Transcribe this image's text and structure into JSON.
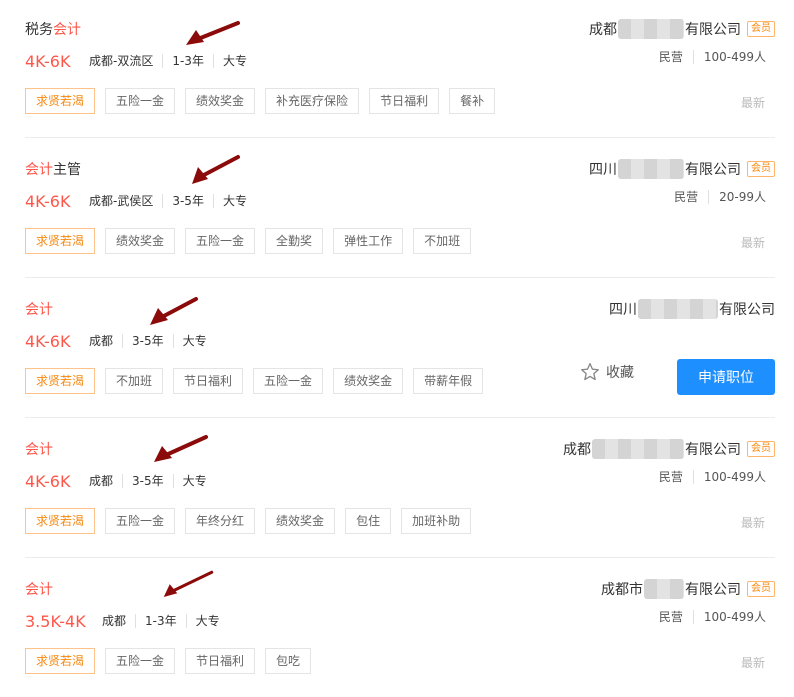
{
  "jobs": [
    {
      "title_pre": "税务",
      "title_hl": "会计",
      "title_post": "",
      "salary": "4K-6K",
      "location": "成都-双流区",
      "experience": "1-3年",
      "education": "大专",
      "tags": [
        "求贤若渴",
        "五险一金",
        "绩效奖金",
        "补充医疗保险",
        "节日福利",
        "餐补"
      ],
      "company_prefix": "成都",
      "company_suffix": "有限公司",
      "vip": "会员",
      "company_type": "民营",
      "company_size": "100-499人",
      "newest": "最新"
    },
    {
      "title_pre": "",
      "title_hl": "会计",
      "title_post": "主管",
      "salary": "4K-6K",
      "location": "成都-武侯区",
      "experience": "3-5年",
      "education": "大专",
      "tags": [
        "求贤若渴",
        "绩效奖金",
        "五险一金",
        "全勤奖",
        "弹性工作",
        "不加班"
      ],
      "company_prefix": "四川",
      "company_suffix": "有限公司",
      "vip": "会员",
      "company_type": "民营",
      "company_size": "20-99人",
      "newest": "最新"
    },
    {
      "title_pre": "",
      "title_hl": "会计",
      "title_post": "",
      "salary": "4K-6K",
      "location": "成都",
      "experience": "3-5年",
      "education": "大专",
      "tags": [
        "求贤若渴",
        "不加班",
        "节日福利",
        "五险一金",
        "绩效奖金",
        "带薪年假"
      ],
      "company_prefix": "四川",
      "company_suffix": "有限公司",
      "fav_label": "收藏",
      "apply_label": "申请职位"
    },
    {
      "title_pre": "",
      "title_hl": "会计",
      "title_post": "",
      "salary": "4K-6K",
      "location": "成都",
      "experience": "3-5年",
      "education": "大专",
      "tags": [
        "求贤若渴",
        "五险一金",
        "年终分红",
        "绩效奖金",
        "包住",
        "加班补助"
      ],
      "company_prefix": "成都",
      "company_suffix": "有限公司",
      "vip": "会员",
      "company_type": "民营",
      "company_size": "100-499人",
      "newest": "最新"
    },
    {
      "title_pre": "",
      "title_hl": "会计",
      "title_post": "",
      "salary": "3.5K-4K",
      "location": "成都",
      "experience": "1-3年",
      "education": "大专",
      "tags": [
        "求贤若渴",
        "五险一金",
        "节日福利",
        "包吃"
      ],
      "company_prefix": "成都市",
      "company_suffix": "有限公司",
      "vip": "会员",
      "company_type": "民营",
      "company_size": "100-499人",
      "newest": "最新"
    }
  ],
  "colors": {
    "accent": "#fe574a",
    "hot_tag": "#f7880e",
    "apply": "#1e8fff",
    "arrow": "#8b0a0a"
  },
  "icons": {
    "favorite": "star-outline-icon",
    "annotation": "arrow-icon"
  }
}
